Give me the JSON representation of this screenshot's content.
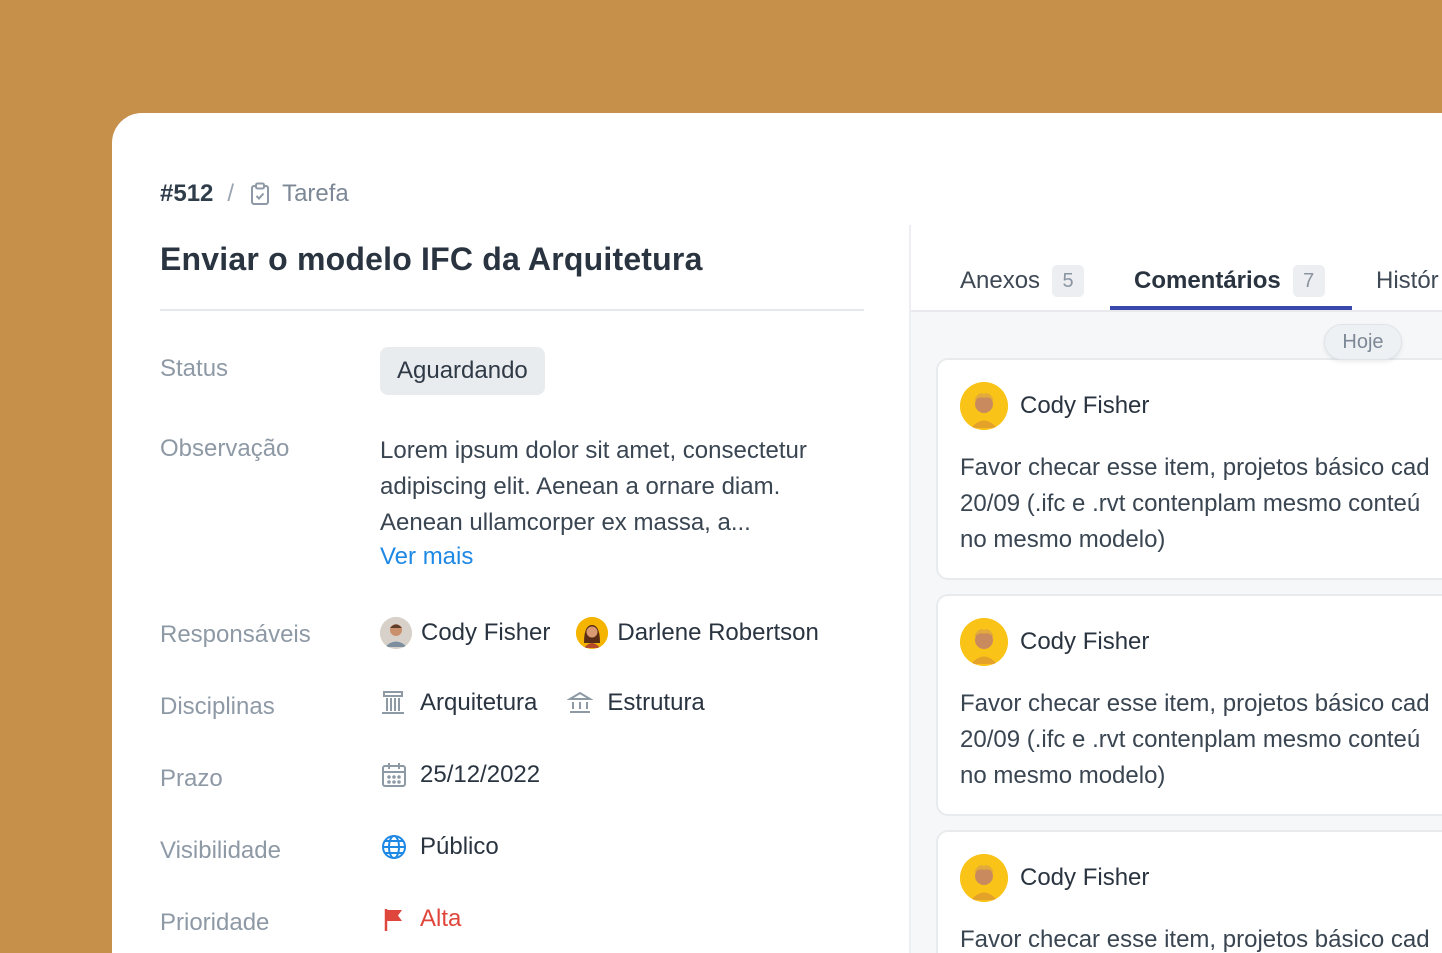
{
  "breadcrumb": {
    "id": "#512",
    "separator": "/",
    "type": "Tarefa"
  },
  "task": {
    "title": "Enviar o modelo IFC da Arquitetura"
  },
  "fields": {
    "status": {
      "label": "Status",
      "value": "Aguardando"
    },
    "observacao": {
      "label": "Observação",
      "lines": [
        "Lorem ipsum dolor sit amet, consectetur",
        "adipiscing elit. Aenean a ornare diam.",
        "Aenean ullamcorper ex massa, a..."
      ],
      "more": "Ver mais"
    },
    "responsaveis": {
      "label": "Responsáveis",
      "people": [
        "Cody Fisher",
        "Darlene Robertson"
      ]
    },
    "disciplinas": {
      "label": "Disciplinas",
      "items": [
        "Arquitetura",
        "Estrutura"
      ]
    },
    "prazo": {
      "label": "Prazo",
      "value": "25/12/2022"
    },
    "visibilidade": {
      "label": "Visibilidade",
      "value": "Público"
    },
    "prioridade": {
      "label": "Prioridade",
      "value": "Alta",
      "color": "#e0473c"
    }
  },
  "tabs": [
    {
      "label": "Anexos",
      "count": "5"
    },
    {
      "label": "Comentários",
      "count": "7",
      "active": true
    },
    {
      "label": "Histór"
    }
  ],
  "day_marker": "Hoje",
  "comments": [
    {
      "author": "Cody Fisher",
      "lines": [
        "Favor checar esse item, projetos básico cad",
        "20/09 (.ifc e .rvt contenplam mesmo conteú",
        "no mesmo modelo)"
      ]
    },
    {
      "author": "Cody Fisher",
      "lines": [
        "Favor checar esse item, projetos básico cad",
        "20/09 (.ifc e .rvt contenplam mesmo conteú",
        "no mesmo modelo)"
      ]
    },
    {
      "author": "Cody Fisher",
      "lines": [
        "Favor checar esse item, projetos básico cad"
      ]
    }
  ],
  "colors": {
    "background": "#c68f4a",
    "accent": "#3949ab",
    "link": "#1e88e5",
    "priority": "#e0473c"
  }
}
